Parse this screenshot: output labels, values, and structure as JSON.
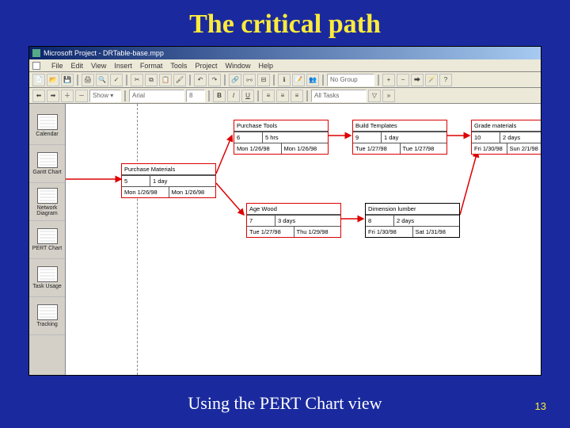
{
  "slide": {
    "title": "The critical path",
    "caption": "Using the PERT Chart view",
    "number": "13"
  },
  "app": {
    "title": "Microsoft Project - DRTable-base.mpp",
    "menus": [
      "File",
      "Edit",
      "View",
      "Insert",
      "Format",
      "Tools",
      "Project",
      "Window",
      "Help"
    ],
    "show_label": "Show ▾",
    "font_name": "Arial",
    "font_size": "8",
    "group_field": "No Group",
    "filter_field": "All Tasks"
  },
  "viewbar": [
    {
      "label": "Calendar"
    },
    {
      "label": "Gantt Chart"
    },
    {
      "label": "Network Diagram"
    },
    {
      "label": "PERT Chart"
    },
    {
      "label": "Task Usage"
    },
    {
      "label": "Tracking"
    }
  ],
  "nodes": {
    "purchase_materials": {
      "title": "Purchase Materials",
      "id": "5",
      "dur": "1 day",
      "start": "Mon 1/26/98",
      "finish": "Mon 1/26/98"
    },
    "purchase_tools": {
      "title": "Purchase Tools",
      "id": "6",
      "dur": "5 hrs",
      "start": "Mon 1/26/98",
      "finish": "Mon 1/26/98"
    },
    "age_wood": {
      "title": "Age Wood",
      "id": "7",
      "dur": "3 days",
      "start": "Tue 1/27/98",
      "finish": "Thu 1/29/98"
    },
    "dimension_lumber": {
      "title": "Dimension lumber",
      "id": "8",
      "dur": "2 days",
      "start": "Fri 1/30/98",
      "finish": "Sat 1/31/98"
    },
    "build_templates": {
      "title": "Build Templates",
      "id": "9",
      "dur": "1 day",
      "start": "Tue 1/27/98",
      "finish": "Tue 1/27/98"
    },
    "grade_materials": {
      "title": "Grade materials",
      "id": "10",
      "dur": "2 days",
      "start": "Fri 1/30/98",
      "finish": "Sun 2/1/98"
    }
  }
}
